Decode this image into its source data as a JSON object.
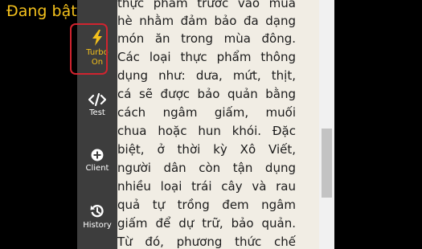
{
  "status": {
    "label": "Đang bật"
  },
  "toolbar": {
    "turbo": {
      "icon": "lightning-icon",
      "line1": "Turbo",
      "line2": "On"
    },
    "test": {
      "icon": "code-icon",
      "label": "Test"
    },
    "client": {
      "icon": "plus-circle-icon",
      "label": "Client"
    },
    "history": {
      "icon": "history-icon",
      "label": "History"
    }
  },
  "article": {
    "lines": [
      "thực phẩm trước vào mùa",
      "hè nhằm đảm bảo đa dạng",
      "món ăn trong mùa đông.",
      "Các loại thực phẩm thông",
      "dụng như: dưa, mứt, thịt,",
      "cá sẽ được bảo quản bằng",
      "cách ngâm giấm, muối",
      "chua hoặc hun khói. Đặc",
      "biệt, ở thời kỳ Xô Viết,",
      "người dân còn tận dụng",
      "nhiều loại trái cây và rau",
      "quả tự trồng đem ngâm",
      "giấm để dự trữ, bảo quản.",
      "Từ đó, phương thức chế"
    ]
  },
  "colors": {
    "accent": "#f3c01c",
    "highlight_border": "#d0242f",
    "toolbar_bg": "#3d3d3d",
    "article_bg": "#f1ede4"
  }
}
